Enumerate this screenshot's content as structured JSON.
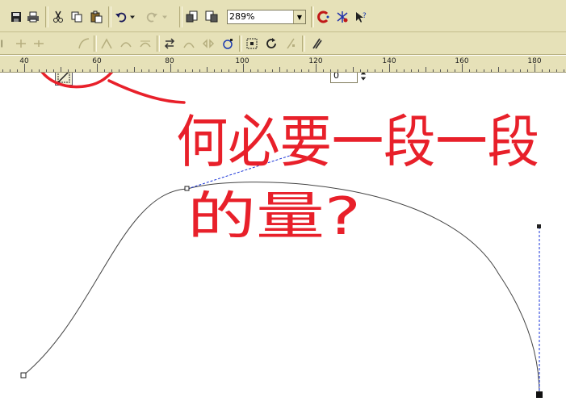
{
  "toolbar": {
    "zoom_value": "289%",
    "nudge_value": "0"
  },
  "ruler": {
    "labels": [
      "40",
      "60",
      "80",
      "100",
      "120",
      "140",
      "160",
      "180"
    ]
  },
  "annotation": {
    "line1": "何必要一段一段",
    "line2": "的量?"
  },
  "colors": {
    "toolbar_bg": "#e6e1b8",
    "annotation_red": "#e8202a",
    "handle_blue": "#1a35d8"
  },
  "icons": [
    "save-icon",
    "print-icon",
    "cut-icon",
    "copy-icon",
    "paste-icon",
    "undo-icon",
    "redo-icon",
    "import-icon",
    "export-icon",
    "corel-connect-icon",
    "application-launcher-icon",
    "whats-this-icon",
    "node-edit-icon"
  ]
}
